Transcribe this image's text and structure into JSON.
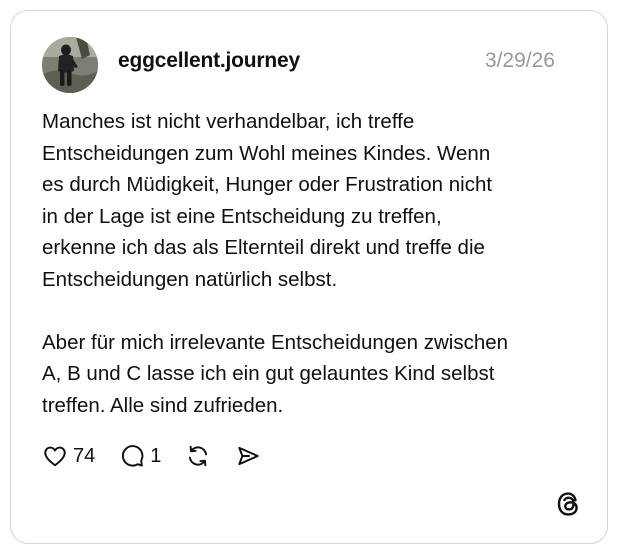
{
  "post": {
    "username": "eggcellent.journey",
    "date": "3/29/26",
    "paragraphs": [
      "Manches ist nicht verhandelbar, ich treffe\nEntscheidungen zum Wohl meines Kindes. Wenn\nes durch Müdigkeit, Hunger oder Frustration nicht\nin der Lage ist eine Entscheidung zu treffen,\nerkenne ich das als Elternteil direkt und treffe die\nEntscheidungen natürlich selbst.",
      "Aber für mich irrelevante Entscheidungen zwischen\nA, B und C lasse ich ein gut gelauntes Kind selbst\ntreffen. Alle sind zufrieden."
    ],
    "likes": "74",
    "replies": "1"
  },
  "icons": {
    "like": "heart-icon",
    "reply": "speech-bubble-icon",
    "repost": "repost-icon",
    "share": "send-icon",
    "brand": "threads-logo-icon",
    "avatar": "profile-photo"
  },
  "colors": {
    "text": "#101010",
    "muted": "#999999",
    "border": "#d6d6d6"
  }
}
